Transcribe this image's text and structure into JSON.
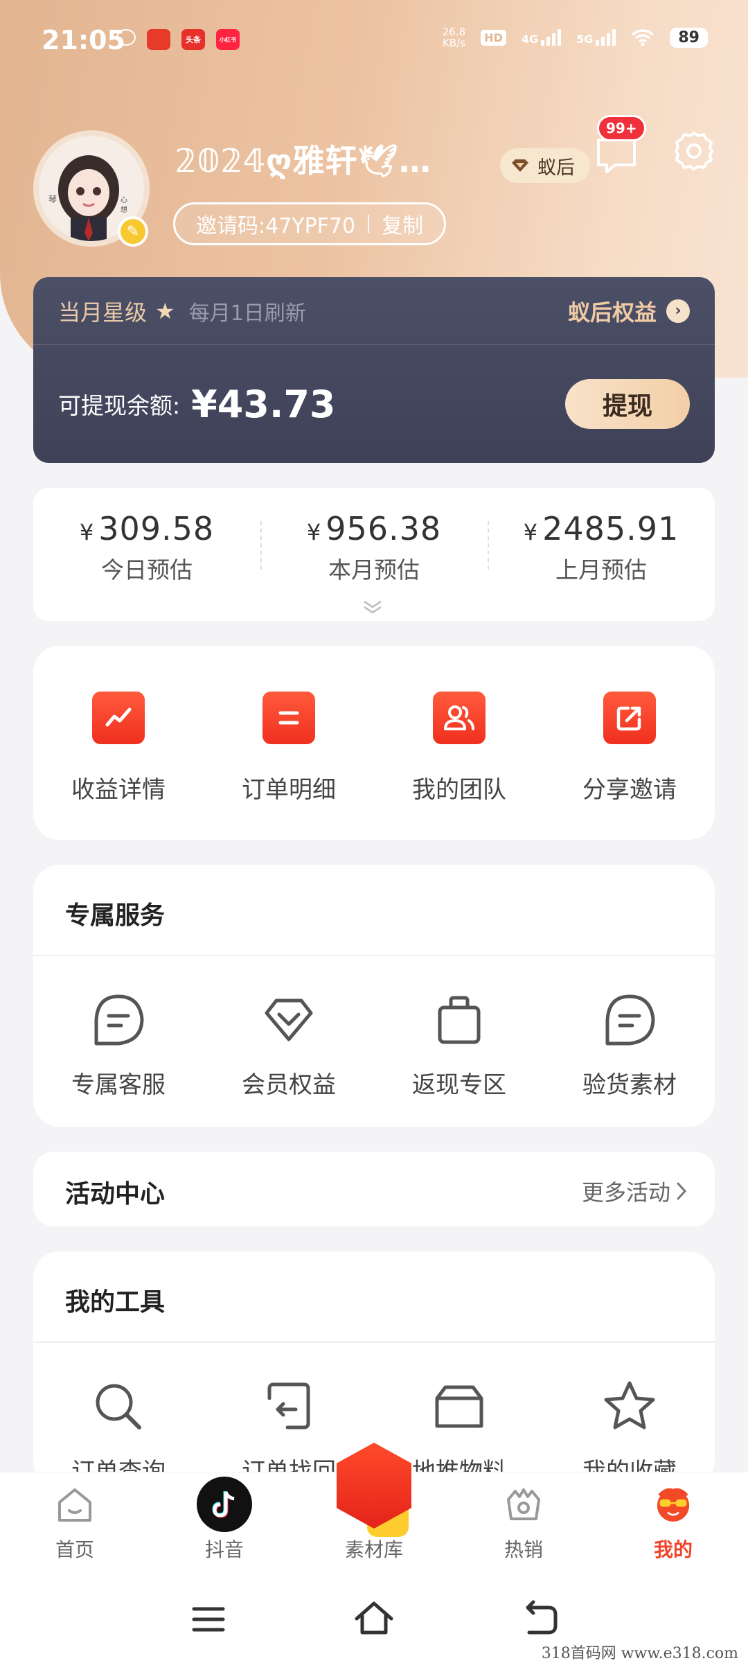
{
  "status_bar": {
    "time": "21:05",
    "app_icons": [
      "头条",
      "小红书"
    ],
    "net_speed_value": "26.8",
    "net_speed_unit": "KB/s",
    "hd_label": "HD",
    "sim1_label": "4G",
    "sim2_label": "5G",
    "battery": "89"
  },
  "profile": {
    "nickname": "𝟚𝟘𝟚𝟜ღ雅轩🕊…",
    "invite_label": "邀请码:47YPF70",
    "copy_label": "复制",
    "level_badge": "蚁后",
    "message_count": "99+"
  },
  "balance_card": {
    "level_label": "当月星级",
    "refresh_note": "每月1日刷新",
    "rights_label": "蚁后权益",
    "balance_label": "可提现余额:",
    "balance_value": "¥43.73",
    "withdraw_label": "提现"
  },
  "estimates": [
    {
      "currency": "¥",
      "value": "309.58",
      "label": "今日预估"
    },
    {
      "currency": "¥",
      "value": "956.38",
      "label": "本月预估"
    },
    {
      "currency": "¥",
      "value": "2485.91",
      "label": "上月预估"
    }
  ],
  "quick_actions": [
    {
      "label": "收益详情",
      "icon": "trend-icon"
    },
    {
      "label": "订单明细",
      "icon": "list-icon"
    },
    {
      "label": "我的团队",
      "icon": "team-icon"
    },
    {
      "label": "分享邀请",
      "icon": "share-icon"
    }
  ],
  "exclusive_services": {
    "title": "专属服务",
    "items": [
      {
        "label": "专属客服",
        "icon": "chat-icon"
      },
      {
        "label": "会员权益",
        "icon": "diamond-icon"
      },
      {
        "label": "返现专区",
        "icon": "bag-icon"
      },
      {
        "label": "验货素材",
        "icon": "chat-icon"
      }
    ]
  },
  "activity_center": {
    "title": "活动中心",
    "more_label": "更多活动"
  },
  "tools": {
    "title": "我的工具",
    "items": [
      {
        "label": "订单查询",
        "icon": "search-icon"
      },
      {
        "label": "订单找回",
        "icon": "retrieve-icon"
      },
      {
        "label": "地推物料",
        "icon": "box-icon"
      },
      {
        "label": "我的收藏",
        "icon": "star-icon"
      }
    ]
  },
  "tab_bar": [
    {
      "label": "首页",
      "icon": "home-icon"
    },
    {
      "label": "抖音",
      "icon": "douyin-icon"
    },
    {
      "label": "素材库",
      "icon": "material-icon"
    },
    {
      "label": "热销",
      "icon": "hot-icon"
    },
    {
      "label": "我的",
      "icon": "mine-icon",
      "active": true
    }
  ],
  "accent_color": "#f0452a",
  "watermark": "318首码网 www.e318.com"
}
